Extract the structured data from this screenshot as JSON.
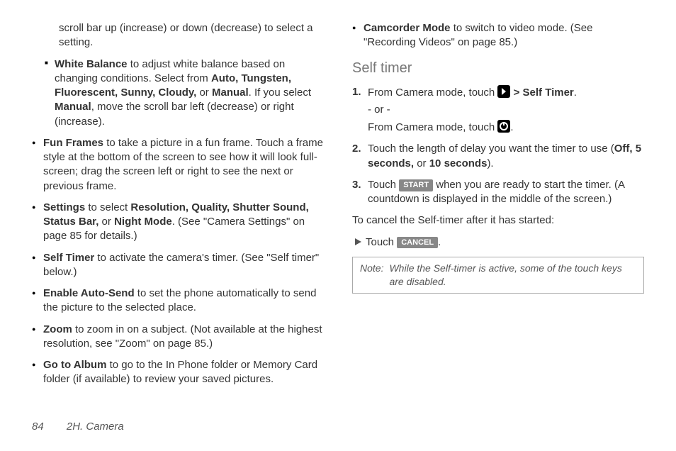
{
  "left": {
    "intro": "scroll bar up (increase) or down (decrease) to select a setting.",
    "whiteBalance": {
      "label": "White Balance",
      "pre": " to adjust white balance based on changing conditions. Select from ",
      "opts": "Auto, Tungsten, Fluorescent, Sunny, Cloudy,",
      "or": " or ",
      "manual": "Manual",
      "post1": ".  If you select ",
      "manual2": "Manual",
      "post2": ", move the scroll bar left (decrease) or right (increase)."
    },
    "bullets": {
      "funFrames": {
        "label": "Fun Frames",
        "text": " to take a picture in a fun frame. Touch a frame style at the bottom of the screen to see how it will look full-screen; drag the screen left or right to see the next or previous frame."
      },
      "settings": {
        "label": "Settings",
        "pre": " to select ",
        "opts": "Resolution, Quality, Shutter Sound, Status Bar,",
        "or": " or ",
        "night": "Night Mode",
        "post": ". (See \"Camera Settings\" on page 85 for details.)"
      },
      "selfTimer": {
        "label": "Self Timer",
        "text": " to activate the camera's timer. (See \"Self timer\" below.)"
      },
      "autoSend": {
        "label": "Enable Auto-Send",
        "text": " to set the phone automatically to send the picture to the selected place."
      },
      "zoom": {
        "label": "Zoom",
        "text": " to zoom in on a subject. (Not available at the highest resolution, see \"Zoom\" on page 85.)"
      },
      "album": {
        "label": "Go to Album",
        "text": " to go to the In Phone folder or Memory Card folder (if available) to review your saved pictures."
      }
    }
  },
  "right": {
    "camcorder": {
      "label": "Camcorder Mode",
      "text": " to switch to video mode. (See \"Recording Videos\" on page 85.)"
    },
    "heading": "Self timer",
    "step1": {
      "pre": "From Camera mode, touch ",
      "gt": " > ",
      "st": "Self Timer",
      "dot": ".",
      "or": "- or -",
      "alt": "From Camera mode, touch ",
      "altdot": "."
    },
    "step2": {
      "pre": "Touch the length of delay you want the timer to use (",
      "opts": "Off, 5 seconds,",
      "or": " or ",
      "ten": "10 seconds",
      "post": ")."
    },
    "step3": {
      "pre": "Touch ",
      "start": "START",
      "post": " when you are ready to start the timer. (A countdown is displayed in the middle of the screen.)"
    },
    "cancelIntro": "To cancel the Self-timer after it has started:",
    "cancelLine": {
      "pre": "Touch ",
      "cancel": "CANCEL",
      "dot": "."
    },
    "note": {
      "label": "Note:",
      "text": "While the Self-timer is active, some of the touch keys are disabled."
    }
  },
  "footer": {
    "page": "84",
    "section": "2H. Camera"
  }
}
